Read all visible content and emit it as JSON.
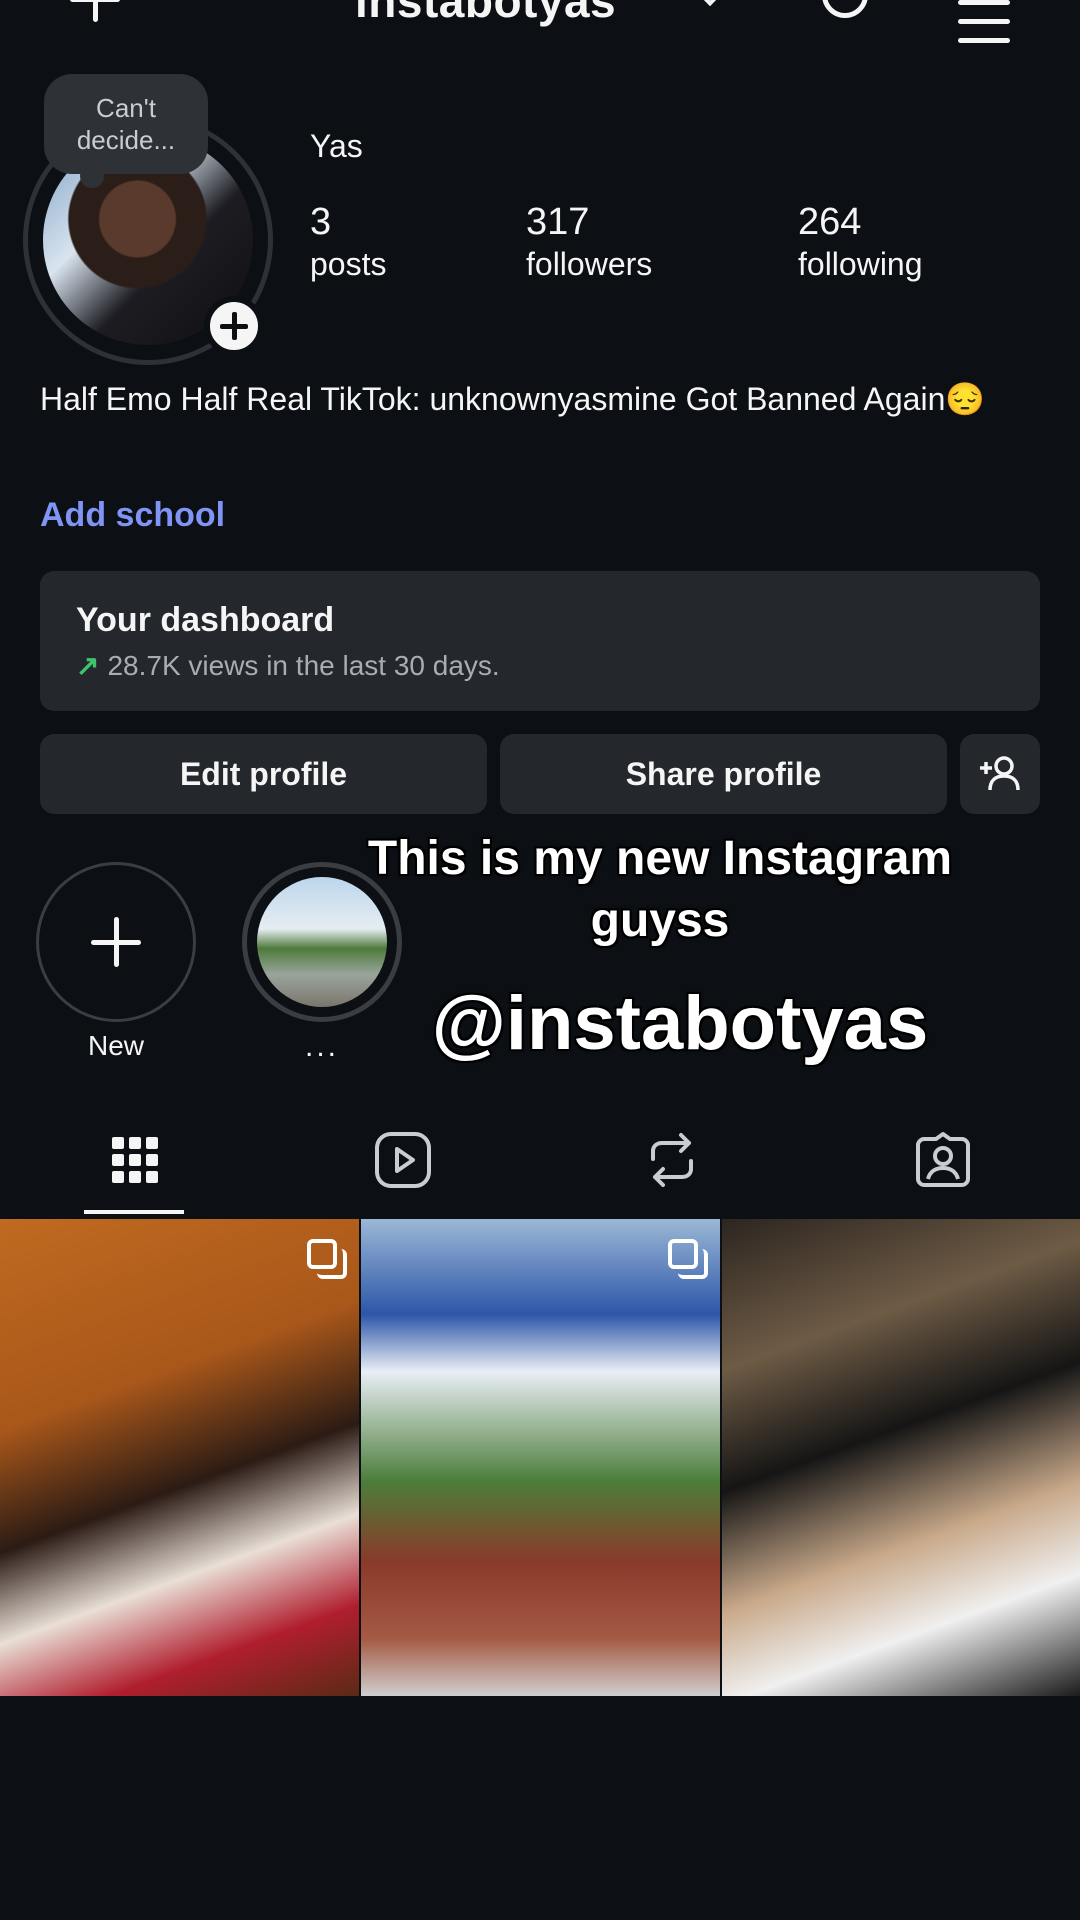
{
  "topbar": {
    "username": "instabotyas"
  },
  "profile": {
    "note": "Can't decide...",
    "display_name": "Yas",
    "stats": {
      "posts": {
        "count": "3",
        "label": "posts"
      },
      "followers": {
        "count": "317",
        "label": "followers"
      },
      "following": {
        "count": "264",
        "label": "following"
      }
    },
    "bio": "Half Emo Half Real TikTok: unknownyasmine Got Banned Again😔",
    "add_school": "Add school"
  },
  "dashboard": {
    "title": "Your dashboard",
    "subtitle": "28.7K views in the last 30 days.",
    "trend_icon": "↗"
  },
  "buttons": {
    "edit": "Edit profile",
    "share": "Share profile"
  },
  "highlights": [
    {
      "label": "New"
    },
    {
      "label": "..."
    }
  ],
  "overlay": {
    "caption_line": "This is my new Instagram guyss",
    "handle": "@instabotyas"
  },
  "tabs": [
    {
      "icon": "grid-icon",
      "active": true
    },
    {
      "icon": "reels-icon",
      "active": false
    },
    {
      "icon": "repost-icon",
      "active": false
    },
    {
      "icon": "tagged-icon",
      "active": false
    }
  ],
  "posts": [
    {
      "alt": "graduation photo",
      "multi": true
    },
    {
      "alt": "Dorney Park photo",
      "multi": true
    },
    {
      "alt": "restaurant photo",
      "multi": false
    }
  ],
  "colors": {
    "background": "#0c1014",
    "link": "#7f94f5",
    "surface": "#24272b",
    "trend": "#3fc46d"
  }
}
